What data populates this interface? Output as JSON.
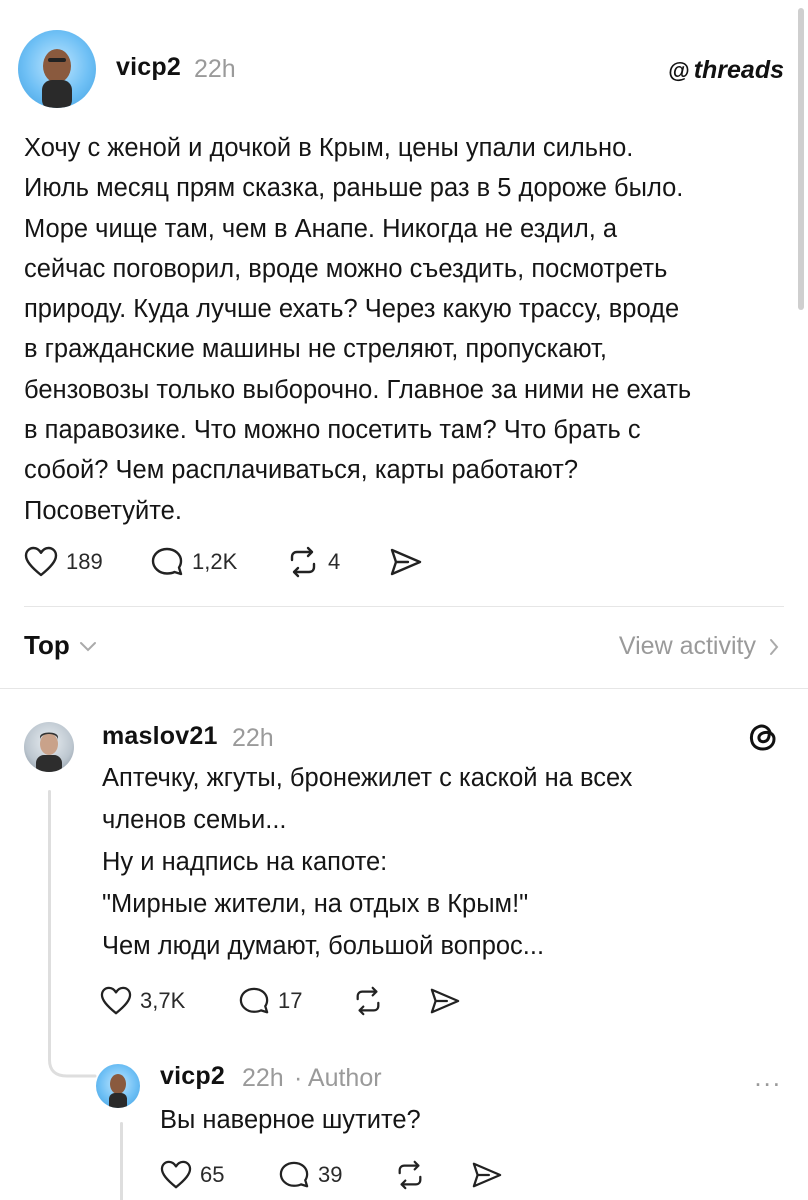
{
  "post": {
    "username": "vicp2",
    "time": "22h",
    "brand": "threads",
    "text": "Хочу с женой и дочкой в Крым, цены упали сильно.\nИюль месяц прям сказка, раньше раз в 5 дороже было.\nМоре чище там, чем в Анапе. Никогда не ездил, а\nсейчас поговорил, вроде можно съездить, посмотреть\nприроду. Куда лучше ехать? Через какую трассу, вроде\nв гражданские машины не стреляют, пропускают,\nбензовозы только выборочно. Главное за ними не ехать\nв паравозике. Что можно посетить там? Что брать с\nсобой? Чем расплачиваться, карты работают?\nПосоветуйте.",
    "likes": "189",
    "comments": "1,2K",
    "reposts": "4"
  },
  "sort": {
    "label": "Top",
    "activity_label": "View activity"
  },
  "reply": {
    "username": "maslov21",
    "time": "22h",
    "lines": [
      "Аптечку, жгуты, бронежилет с каской на всех",
      "членов семьи...",
      "Ну и надпись на капоте:",
      "\"Мирные жители, на отдых в Крым!\"",
      "Чем люди думают, большой вопрос..."
    ],
    "likes": "3,7K",
    "comments": "17"
  },
  "nested_reply": {
    "username": "vicp2",
    "time": "22h",
    "author_tag": "· Author",
    "text": "Вы наверное шутите?",
    "likes": "65",
    "comments": "39",
    "more": "..."
  },
  "icons": {
    "like": "heart-icon",
    "comment": "comment-bubble-icon",
    "repost": "repost-icon",
    "share": "send-icon",
    "brand": "threads-logo-icon"
  },
  "colors": {
    "muted": "#9a9a9a",
    "text": "#151515",
    "divider": "#e6e6e6"
  }
}
